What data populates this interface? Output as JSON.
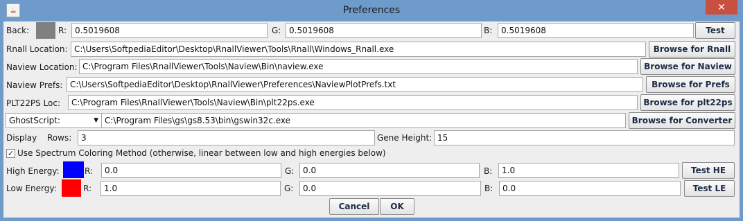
{
  "window": {
    "title": "Preferences",
    "app_icon": "java-icon",
    "close_label": "✕"
  },
  "back": {
    "label": "Back:",
    "swatch_color": "#808080",
    "r_label": "R:",
    "r_value": "0.5019608",
    "g_label": "G:",
    "g_value": "0.5019608",
    "b_label": "B:",
    "b_value": "0.5019608",
    "test_label": "Test"
  },
  "rnall": {
    "label": "Rnall Location:",
    "value": "C:\\Users\\SoftpediaEditor\\Desktop\\RnallViewer\\Tools\\Rnall\\Windows_Rnall.exe",
    "button": "Browse for Rnall"
  },
  "naview": {
    "label": "Naview Location:",
    "value": "C:\\Program Files\\RnallViewer\\Tools\\Naview\\Bin\\naview.exe",
    "button": "Browse for Naview"
  },
  "prefs": {
    "label": "Naview Prefs:",
    "value": "C:\\Users\\SoftpediaEditor\\Desktop\\RnallViewer\\Preferences\\NaviewPlotPrefs.txt",
    "button": "Browse for Prefs"
  },
  "plt22ps": {
    "label": "PLT22PS Loc:",
    "value": "C:\\Program Files\\RnallViewer\\Tools\\Naview\\Bin\\plt22ps.exe",
    "button": "Browse for plt22ps"
  },
  "converter": {
    "select_value": "GhostScript:",
    "value": "C:\\Program Files\\gs\\gs8.53\\bin\\gswin32c.exe",
    "button": "Browse for Converter"
  },
  "display": {
    "label": "Display",
    "rows_label": "Rows:",
    "rows_value": "3",
    "gene_label": "Gene Height:",
    "gene_value": "15"
  },
  "spectrum": {
    "checked": true,
    "label": "Use Spectrum Coloring Method (otherwise, linear between low and high energies below)"
  },
  "high": {
    "label": "High Energy:",
    "swatch_color": "#0000ff",
    "r_label": "R:",
    "r_value": "0.0",
    "g_label": "G:",
    "g_value": "0.0",
    "b_label": "B:",
    "b_value": "1.0",
    "button": "Test HE"
  },
  "low": {
    "label": "Low Energy:",
    "swatch_color": "#ff0000",
    "r_label": "R:",
    "r_value": "1.0",
    "g_label": "G:",
    "g_value": "0.0",
    "b_label": "B:",
    "b_value": "0.0",
    "button": "Test LE"
  },
  "actions": {
    "cancel": "Cancel",
    "ok": "OK"
  }
}
